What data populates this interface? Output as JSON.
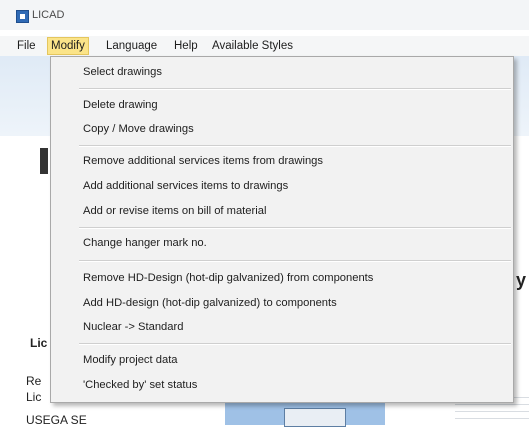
{
  "window": {
    "title": "LICAD"
  },
  "menubar": {
    "items": [
      "File",
      "Modify",
      "Language",
      "Help",
      "Available Styles"
    ]
  },
  "dropdown": {
    "items": [
      "Select drawings",
      "Delete drawing",
      "Copy / Move drawings",
      "Remove additional services items from drawings",
      "Add additional services items to drawings",
      "Add or revise items on bill of material",
      "Change hanger mark no.",
      "Remove HD-Design (hot-dip galvanized) from components",
      "Add HD-design (hot-dip galvanized) to components",
      "Nuclear -> Standard",
      "Modify project data",
      "'Checked by' set status"
    ]
  },
  "background": {
    "heading_fragment": "Lic",
    "line1_fragment": "Re",
    "line2_fragment": "Lic",
    "company": "USEGA SE",
    "right_fragment": "y"
  }
}
